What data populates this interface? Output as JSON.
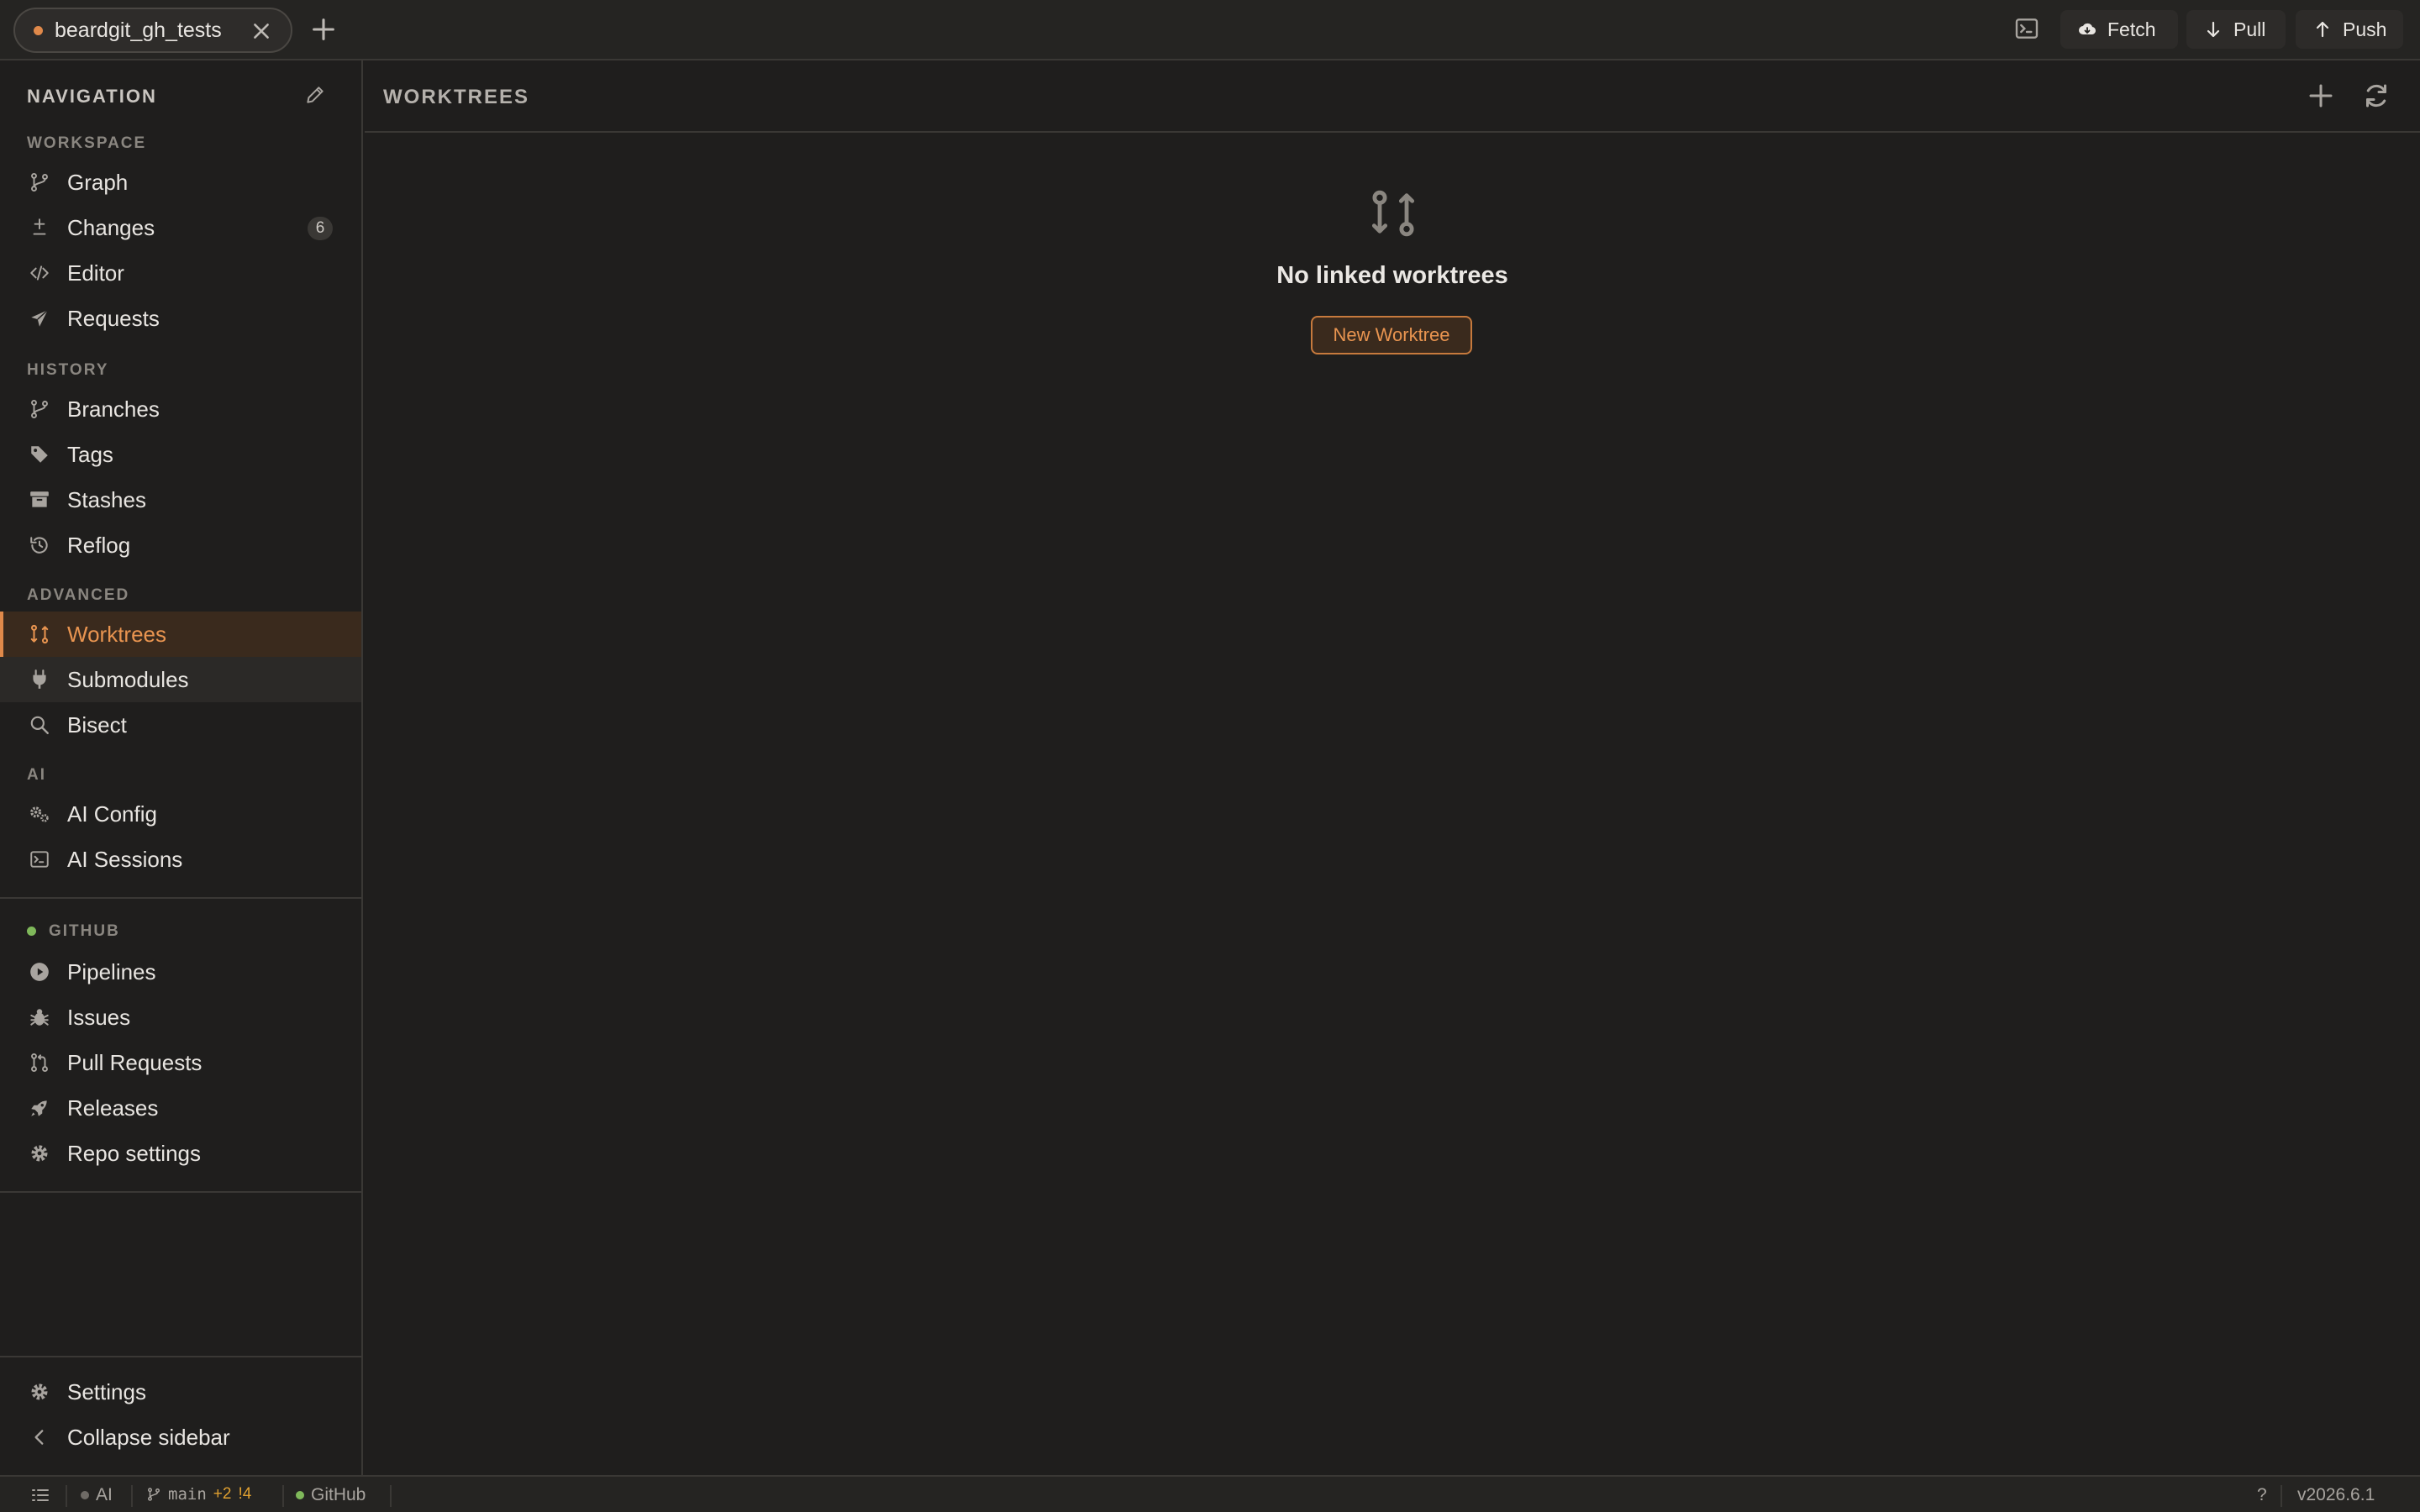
{
  "tabs": [
    {
      "label": "beardgit_gh_tests",
      "modified": true
    }
  ],
  "toolbar": {
    "fetch_label": "Fetch",
    "pull_label": "Pull",
    "push_label": "Push"
  },
  "sidebar": {
    "title": "NAVIGATION",
    "sections": {
      "workspace": "WORKSPACE",
      "history": "HISTORY",
      "advanced": "ADVANCED",
      "ai": "AI",
      "github": "GITHUB"
    },
    "items": {
      "graph": "Graph",
      "changes": "Changes",
      "changes_count": "6",
      "editor": "Editor",
      "requests": "Requests",
      "branches": "Branches",
      "tags": "Tags",
      "stashes": "Stashes",
      "reflog": "Reflog",
      "worktrees": "Worktrees",
      "submodules": "Submodules",
      "bisect": "Bisect",
      "ai_config": "AI Config",
      "ai_sessions": "AI Sessions",
      "pipelines": "Pipelines",
      "issues": "Issues",
      "pull_requests": "Pull Requests",
      "releases": "Releases",
      "repo_settings": "Repo settings",
      "settings": "Settings",
      "collapse": "Collapse sidebar"
    },
    "active_item": "Worktrees",
    "github_status_color": "#7fb85a"
  },
  "main": {
    "title": "WORKTREES",
    "empty_title": "No linked worktrees",
    "new_worktree_label": "New Worktree"
  },
  "statusbar": {
    "ai_label": "AI",
    "branch": "main",
    "ahead": "+2",
    "changes": "!4",
    "provider": "GitHub",
    "help": "?",
    "version": "v2026.6.1"
  },
  "colors": {
    "accent": "#e0894a",
    "background": "#1f1e1d",
    "success": "#7fb85a"
  }
}
